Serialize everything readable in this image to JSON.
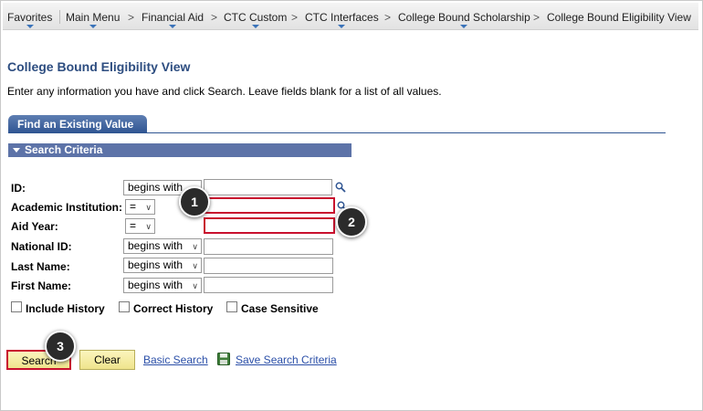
{
  "breadcrumb": {
    "items": [
      {
        "label": "Favorites"
      },
      {
        "label": "Main Menu"
      },
      {
        "label": "Financial Aid"
      },
      {
        "label": "CTC Custom"
      },
      {
        "label": "CTC Interfaces"
      },
      {
        "label": "College Bound Scholarship"
      },
      {
        "label": "College Bound Eligibility View"
      }
    ],
    "separator": ">"
  },
  "page": {
    "title": "College Bound Eligibility View",
    "instructions": "Enter any information you have and click Search. Leave fields blank for a list of all values."
  },
  "tab": {
    "label": "Find an Existing Value"
  },
  "section": {
    "label": "Search Criteria"
  },
  "fields": [
    {
      "label": "ID:",
      "operator": "begins with",
      "value": "",
      "has_lookup": true
    },
    {
      "label": "Academic Institution:",
      "operator": "=",
      "value": "",
      "has_lookup": true
    },
    {
      "label": "Aid Year:",
      "operator": "=",
      "value": "",
      "has_lookup": false
    },
    {
      "label": "National ID:",
      "operator": "begins with",
      "value": "",
      "has_lookup": false
    },
    {
      "label": "Last Name:",
      "operator": "begins with",
      "value": "",
      "has_lookup": false
    },
    {
      "label": "First Name:",
      "operator": "begins with",
      "value": "",
      "has_lookup": false
    }
  ],
  "checkboxes": [
    {
      "label": "Include History",
      "checked": false
    },
    {
      "label": "Correct History",
      "checked": false
    },
    {
      "label": "Case Sensitive",
      "checked": false
    }
  ],
  "buttons": {
    "search": "Search",
    "clear": "Clear",
    "basic_search": "Basic Search",
    "save_search": "Save Search Criteria"
  },
  "markers": [
    "1",
    "2",
    "3"
  ],
  "colors": {
    "title": "#2d4d80",
    "tab": "#2f5592",
    "section": "#5d73a8",
    "highlight": "#c8102e",
    "button": "#f5eda3",
    "link": "#2b4fa8",
    "menu_arrow": "#3b73b9"
  },
  "icons": {
    "lookup": "magnifier-icon",
    "save": "floppy-disk-icon",
    "section_toggle": "triangle-down-icon"
  }
}
